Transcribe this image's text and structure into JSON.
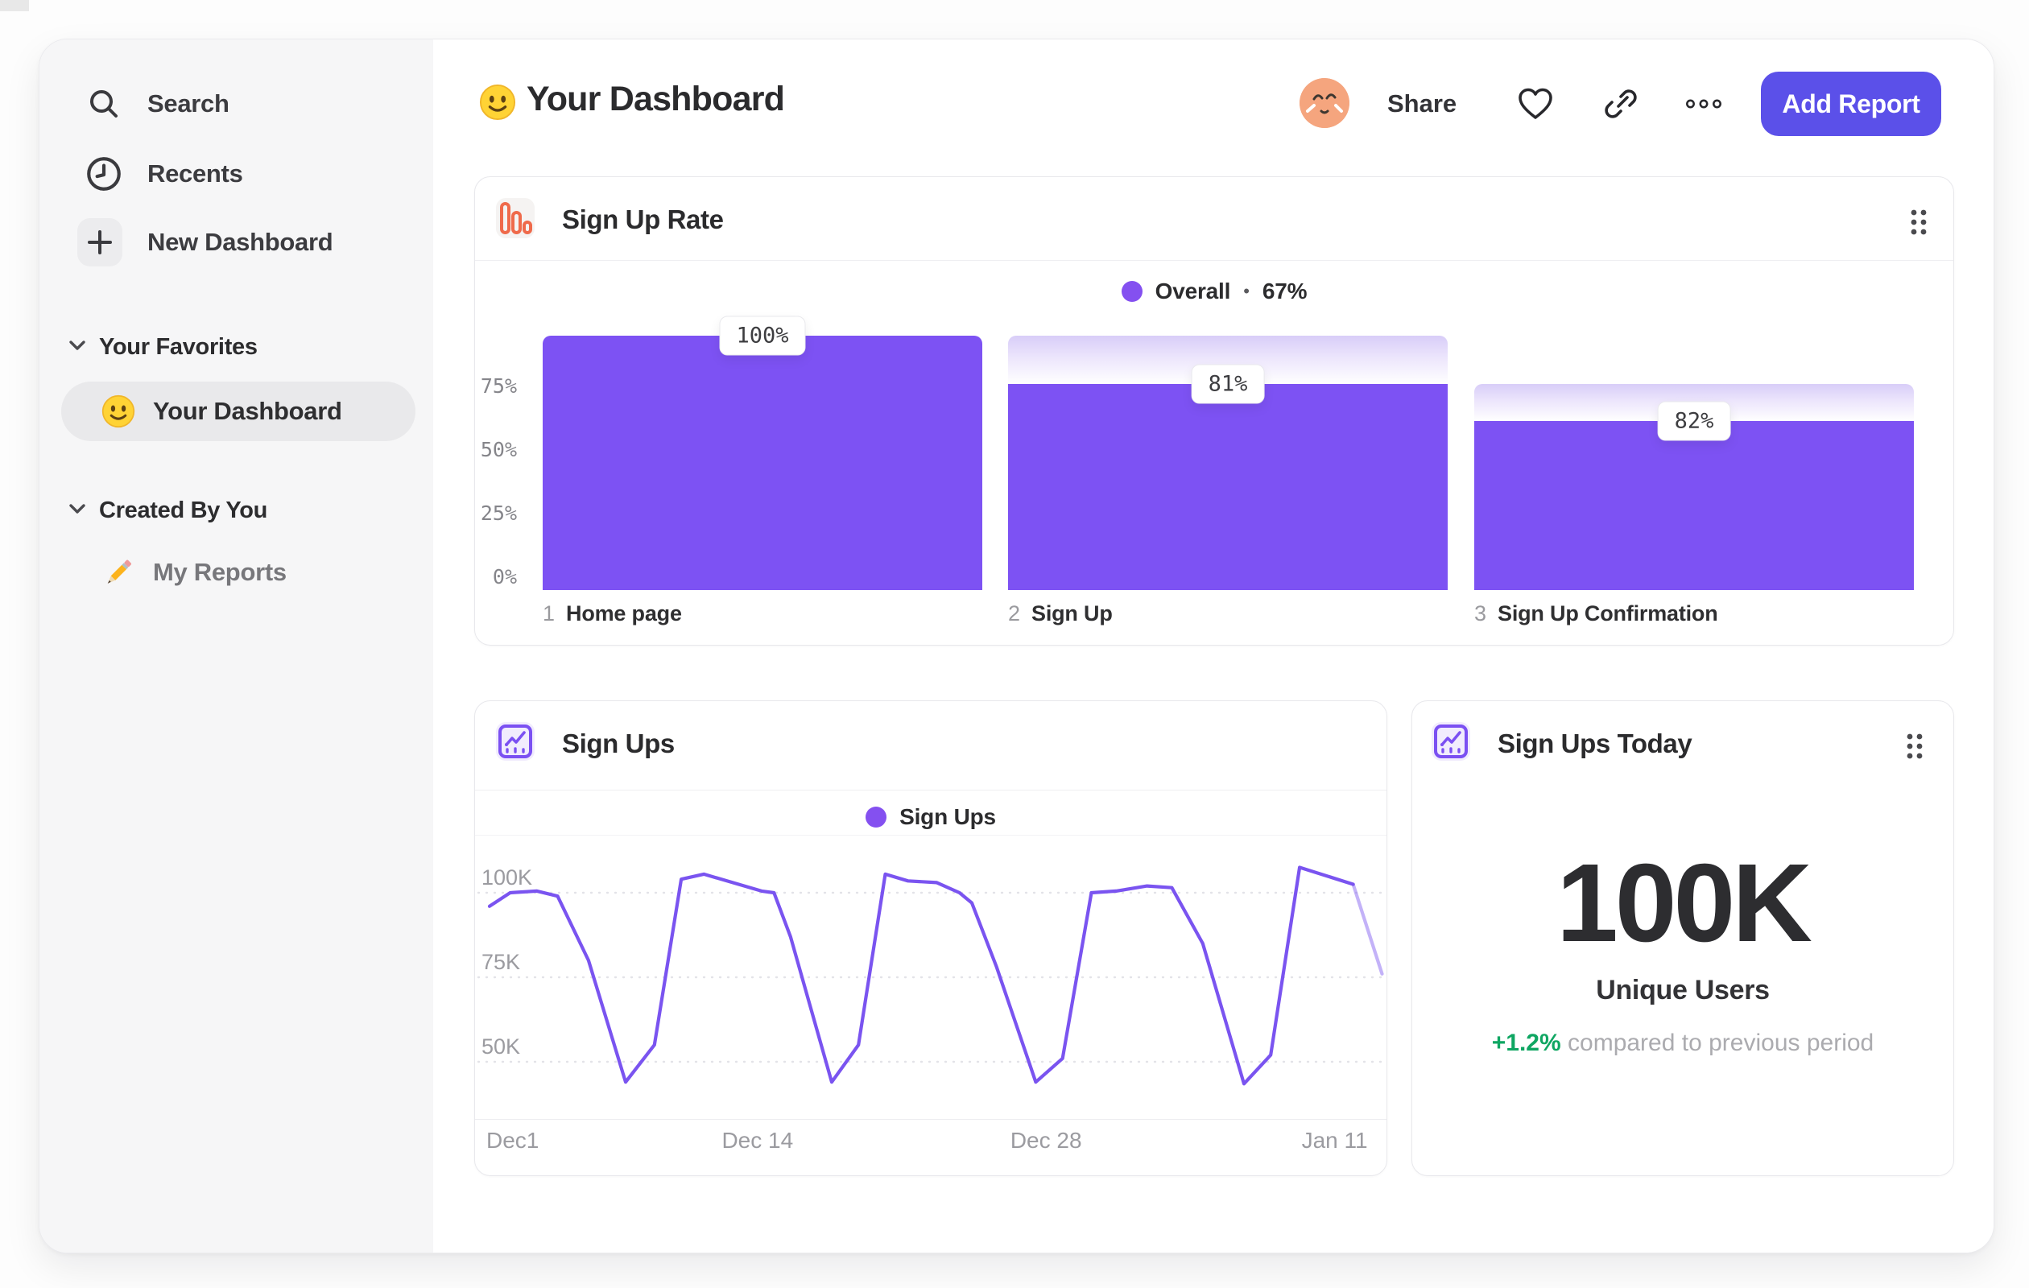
{
  "accent": {
    "purple_bar": "#7d52f3",
    "purple_line": "#7a54f0",
    "button_purple": "#5b50e9",
    "orange_icon": "#ef6a4b",
    "green_delta": "#0fa662"
  },
  "sidebar": {
    "nav": [
      {
        "label": "Search"
      },
      {
        "label": "Recents"
      },
      {
        "label": "New Dashboard"
      }
    ],
    "favorites_header": "Your Favorites",
    "favorites": [
      {
        "label": "Your Dashboard",
        "selected": true
      }
    ],
    "created_header": "Created By You",
    "created": [
      {
        "label": "My Reports"
      }
    ]
  },
  "header": {
    "title": "Your Dashboard",
    "share": "Share",
    "add_report": "Add Report"
  },
  "cards": {
    "funnel": {
      "title": "Sign Up Rate",
      "legend_name": "Overall",
      "legend_sep": "•",
      "legend_value": "67%"
    },
    "signups": {
      "title": "Sign Ups",
      "legend_name": "Sign Ups"
    },
    "today": {
      "title": "Sign Ups Today",
      "value": "100K",
      "label": "Unique Users",
      "delta": "+1.2%",
      "caption": "compared to previous period"
    }
  },
  "chart_data": [
    {
      "type": "bar",
      "chart": "funnel",
      "title": "Sign Up Rate",
      "overall_conversion": "67%",
      "steps": [
        {
          "n": "1",
          "label": "Home page",
          "conversion_from_previous": "100%",
          "cumulative_pct": 100
        },
        {
          "n": "2",
          "label": "Sign Up",
          "conversion_from_previous": "81%",
          "cumulative_pct": 81
        },
        {
          "n": "3",
          "label": "Sign Up Confirmation",
          "conversion_from_previous": "82%",
          "cumulative_pct": 66.4
        }
      ],
      "yticks": [
        {
          "label": "75%",
          "pct": 75
        },
        {
          "label": "50%",
          "pct": 50
        },
        {
          "label": "25%",
          "pct": 25
        },
        {
          "label": "0%",
          "pct": 0
        }
      ],
      "ylim": [
        0,
        105
      ],
      "legend_position": "top-center",
      "bar_color": "#7d52f3"
    },
    {
      "type": "line",
      "chart": "signups",
      "title": "Sign Ups",
      "series": [
        {
          "name": "Sign Ups",
          "color": "#7a54f0"
        }
      ],
      "unit": "K",
      "points": [
        [
          0,
          96
        ],
        [
          1,
          100
        ],
        [
          2.3,
          100.5
        ],
        [
          3.3,
          99
        ],
        [
          4.8,
          80
        ],
        [
          6.6,
          44
        ],
        [
          8,
          55
        ],
        [
          9.3,
          104
        ],
        [
          10.4,
          105.5
        ],
        [
          11.8,
          103
        ],
        [
          13.2,
          100.5
        ],
        [
          13.8,
          100
        ],
        [
          14.6,
          87
        ],
        [
          16.6,
          44
        ],
        [
          17.9,
          55
        ],
        [
          19.2,
          105.5
        ],
        [
          20.3,
          103.5
        ],
        [
          21.7,
          103
        ],
        [
          22.8,
          100
        ],
        [
          23.4,
          97
        ],
        [
          24.6,
          78
        ],
        [
          26.5,
          44
        ],
        [
          27.8,
          51
        ],
        [
          29.2,
          100
        ],
        [
          30.4,
          100.5
        ],
        [
          31.9,
          102
        ],
        [
          33.1,
          101.5
        ],
        [
          34.6,
          85
        ],
        [
          36.6,
          43.5
        ],
        [
          37.9,
          52
        ],
        [
          39.3,
          107.5
        ],
        [
          40.6,
          105
        ],
        [
          41.9,
          102.5
        ],
        [
          43.3,
          76
        ]
      ],
      "yticks": [
        {
          "label": "100K",
          "value": 100
        },
        {
          "label": "75K",
          "value": 75
        },
        {
          "label": "50K",
          "value": 50
        }
      ],
      "xticks": [
        {
          "label": "Dec1",
          "day": 0
        },
        {
          "label": "Dec 14",
          "day": 13
        },
        {
          "label": "Dec 28",
          "day": 27
        },
        {
          "label": "Jan 11",
          "day": 41
        }
      ],
      "ylim": [
        40,
        110
      ],
      "grid": "dotted-horizontal",
      "legend_position": "top-center",
      "faded_tail_segments": 1
    },
    {
      "type": "metric",
      "chart": "today",
      "title": "Sign Ups Today",
      "value": "100K",
      "label": "Unique Users",
      "delta": "+1.2%",
      "delta_positive": true,
      "caption": "compared to previous period"
    }
  ]
}
